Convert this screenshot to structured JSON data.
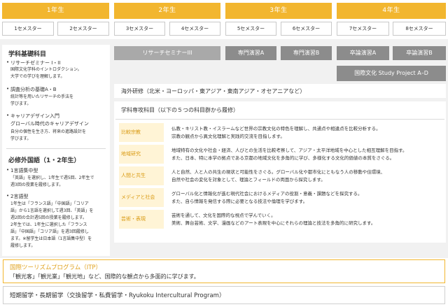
{
  "years": [
    "1年生",
    "2年生",
    "3年生",
    "4年生"
  ],
  "semesters": [
    "1セメスター",
    "2セメスター",
    "3セメスター",
    "4セメスター",
    "5セメスター",
    "6セメスター",
    "7セメスター",
    "8セメスター"
  ],
  "bars": {
    "research_seminar": "リサーチセミナーIII",
    "senmon_a": "専門演習A",
    "senmon_b": "専門演習B",
    "sotsuron_a": "卒論演習A",
    "sotsuron_b": "卒論演習B",
    "study_project": "国際文化 Study Project A–D"
  },
  "left": {
    "basic_title": "学科基礎科目",
    "rs_title": "リサーチゼミナー I・II",
    "rs_desc": [
      "国際文化学科のイントロダクション。",
      "大学での学びを理解します。"
    ],
    "survey_title": "調査分析の基礎A・B",
    "survey_desc": [
      "統計等を用いたリサーチの手法を",
      "学びます。"
    ],
    "career_title": "キャリアデザイン入門",
    "career_subtitle": "グローバル時代のキャリアデザイン",
    "career_desc": [
      "自分の個性を生き方、将来の進路設計を",
      "学びます。"
    ],
    "lang_title": "必修外国語（1・2年生）",
    "english_title": "1言語集中型",
    "english_desc": [
      "「英語」を選択し、1年生で週5回、2年生で",
      "週3回の授業を履修します。"
    ],
    "two_lang_title": "2言語型",
    "two_lang_desc": [
      "1年生は「フランス語」「中国語」「コリア",
      "語」から1言語を選択して週3回、「英語」を",
      "週2回の合計週5回の授業を履修します。",
      "2年生では、1年生に選択した「フランス",
      "語」「中国語」「コリア語」を週3回履修し",
      "ます。※留学生は日本語（1言語集中型）を",
      "履修します。"
    ]
  },
  "overseas": "海外研修（北米・ヨーロッパ・東アジア・東南アジア・オセアニアなど）",
  "specialty_title": "学科専攻科目（以下の５つの科目群から履修）",
  "categories": [
    {
      "name": "比較宗教",
      "desc": [
        "仏教・キリスト教・イスラームなど世界の宗教文化の特色を理解し、共通点や相違点を比較分析する。",
        "宗教の観点から異文化理解と実践的交流を目指します。"
      ]
    },
    {
      "name": "地域研究",
      "desc": [
        "地域特有の文化や社会・経済、人びとの生活を比較考察して、アジア・太平洋地域を中心とした相互理解を目指す。",
        "また、日本、特に本学の拠点である京都の地域文化を多角的に学び、多様化する文化的価値の本質をさぐる。"
      ]
    },
    {
      "name": "人間と共生",
      "desc": [
        "人と自然、人と人の共生の現状と可能性をさぐる。グローバル化や都市化にともなう人の移動や住環境、",
        "自然や社会の変化を対象として、理論とフィールドの両面から探究します。"
      ]
    },
    {
      "name": "メディアと社会",
      "desc": [
        "グローバル化と情報化が進む現代社会におけるメディアの役割・意義・課題などを探究する。",
        "また、自ら情報を発信する際に必要となる技法や倫理を学びます。"
      ]
    },
    {
      "name": "芸術・表現",
      "desc": [
        "芸術を通して、文化を国際的な視点で学んでいく。",
        "美術、舞台芸術、文学、漫画などのアート表現を中心にそれらの理論と技法を多角的に研究します。"
      ]
    }
  ],
  "itp": {
    "title": "国際ツーリズムプログラム（ITP）",
    "desc": "「観光客」「観光業」「観光地」など、国際的な観点から多面的に学びます。"
  },
  "exchange": "短期留学・長期留学（交換留学・私費留学・Ryukoku Intercultural Program）"
}
